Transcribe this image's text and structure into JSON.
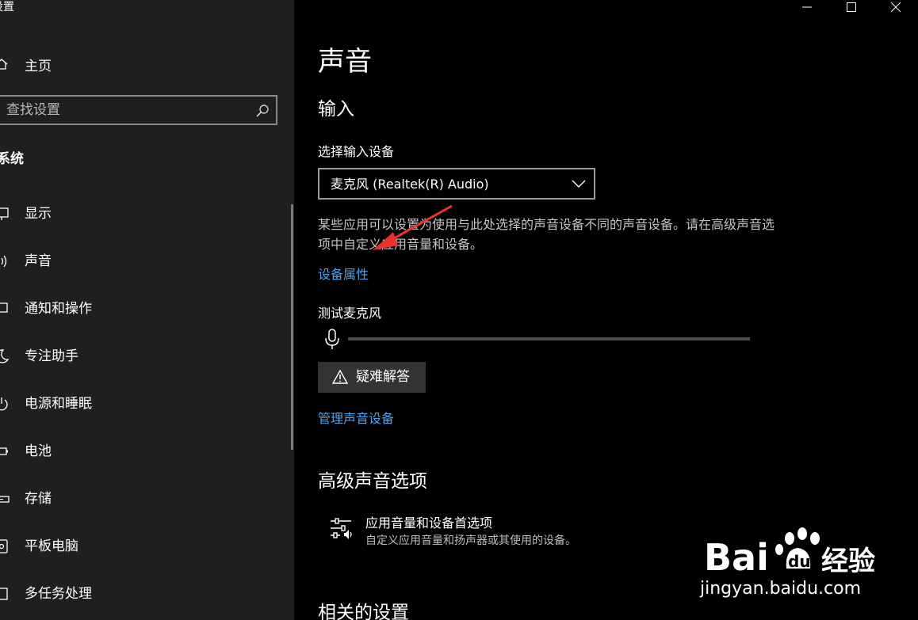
{
  "window": {
    "title": "设置"
  },
  "sidebar": {
    "home_label": "主页",
    "search_placeholder": "查找设置",
    "section_heading": "系统",
    "items": [
      {
        "label": "显示",
        "icon": "display-icon"
      },
      {
        "label": "声音",
        "icon": "speaker-icon"
      },
      {
        "label": "通知和操作",
        "icon": "notification-icon"
      },
      {
        "label": "专注助手",
        "icon": "moon-icon"
      },
      {
        "label": "电源和睡眠",
        "icon": "power-icon"
      },
      {
        "label": "电池",
        "icon": "battery-icon"
      },
      {
        "label": "存储",
        "icon": "storage-icon"
      },
      {
        "label": "平板电脑",
        "icon": "tablet-icon"
      },
      {
        "label": "多任务处理",
        "icon": "multitask-icon"
      }
    ]
  },
  "main": {
    "title": "声音",
    "input": {
      "heading": "输入",
      "select_label": "选择输入设备",
      "selected_device": "麦克风 (Realtek(R) Audio)",
      "info_text": "某些应用可以设置为使用与此处选择的声音设备不同的声音设备。请在高级声音选项中自定义应用音量和设备。",
      "device_properties_link": "设备属性",
      "test_mic_label": "测试麦克风",
      "mic_level": 0,
      "troubleshoot_label": "疑难解答",
      "manage_devices_link": "管理声音设备"
    },
    "advanced": {
      "heading": "高级声音选项",
      "app_volume_title": "应用音量和设备首选项",
      "app_volume_desc": "自定义应用音量和扬声器或其使用的设备。"
    },
    "related_heading": "相关的设置"
  },
  "watermark": {
    "brand": "Bai",
    "brand_suffix": "du",
    "service": "经验",
    "url": "jingyan.baidu.com"
  },
  "colors": {
    "sidebar_bg": "#1f1f1f",
    "main_bg": "#000000",
    "link": "#4ea3ea",
    "button_bg": "#333333",
    "annotation": "#e8322c"
  }
}
